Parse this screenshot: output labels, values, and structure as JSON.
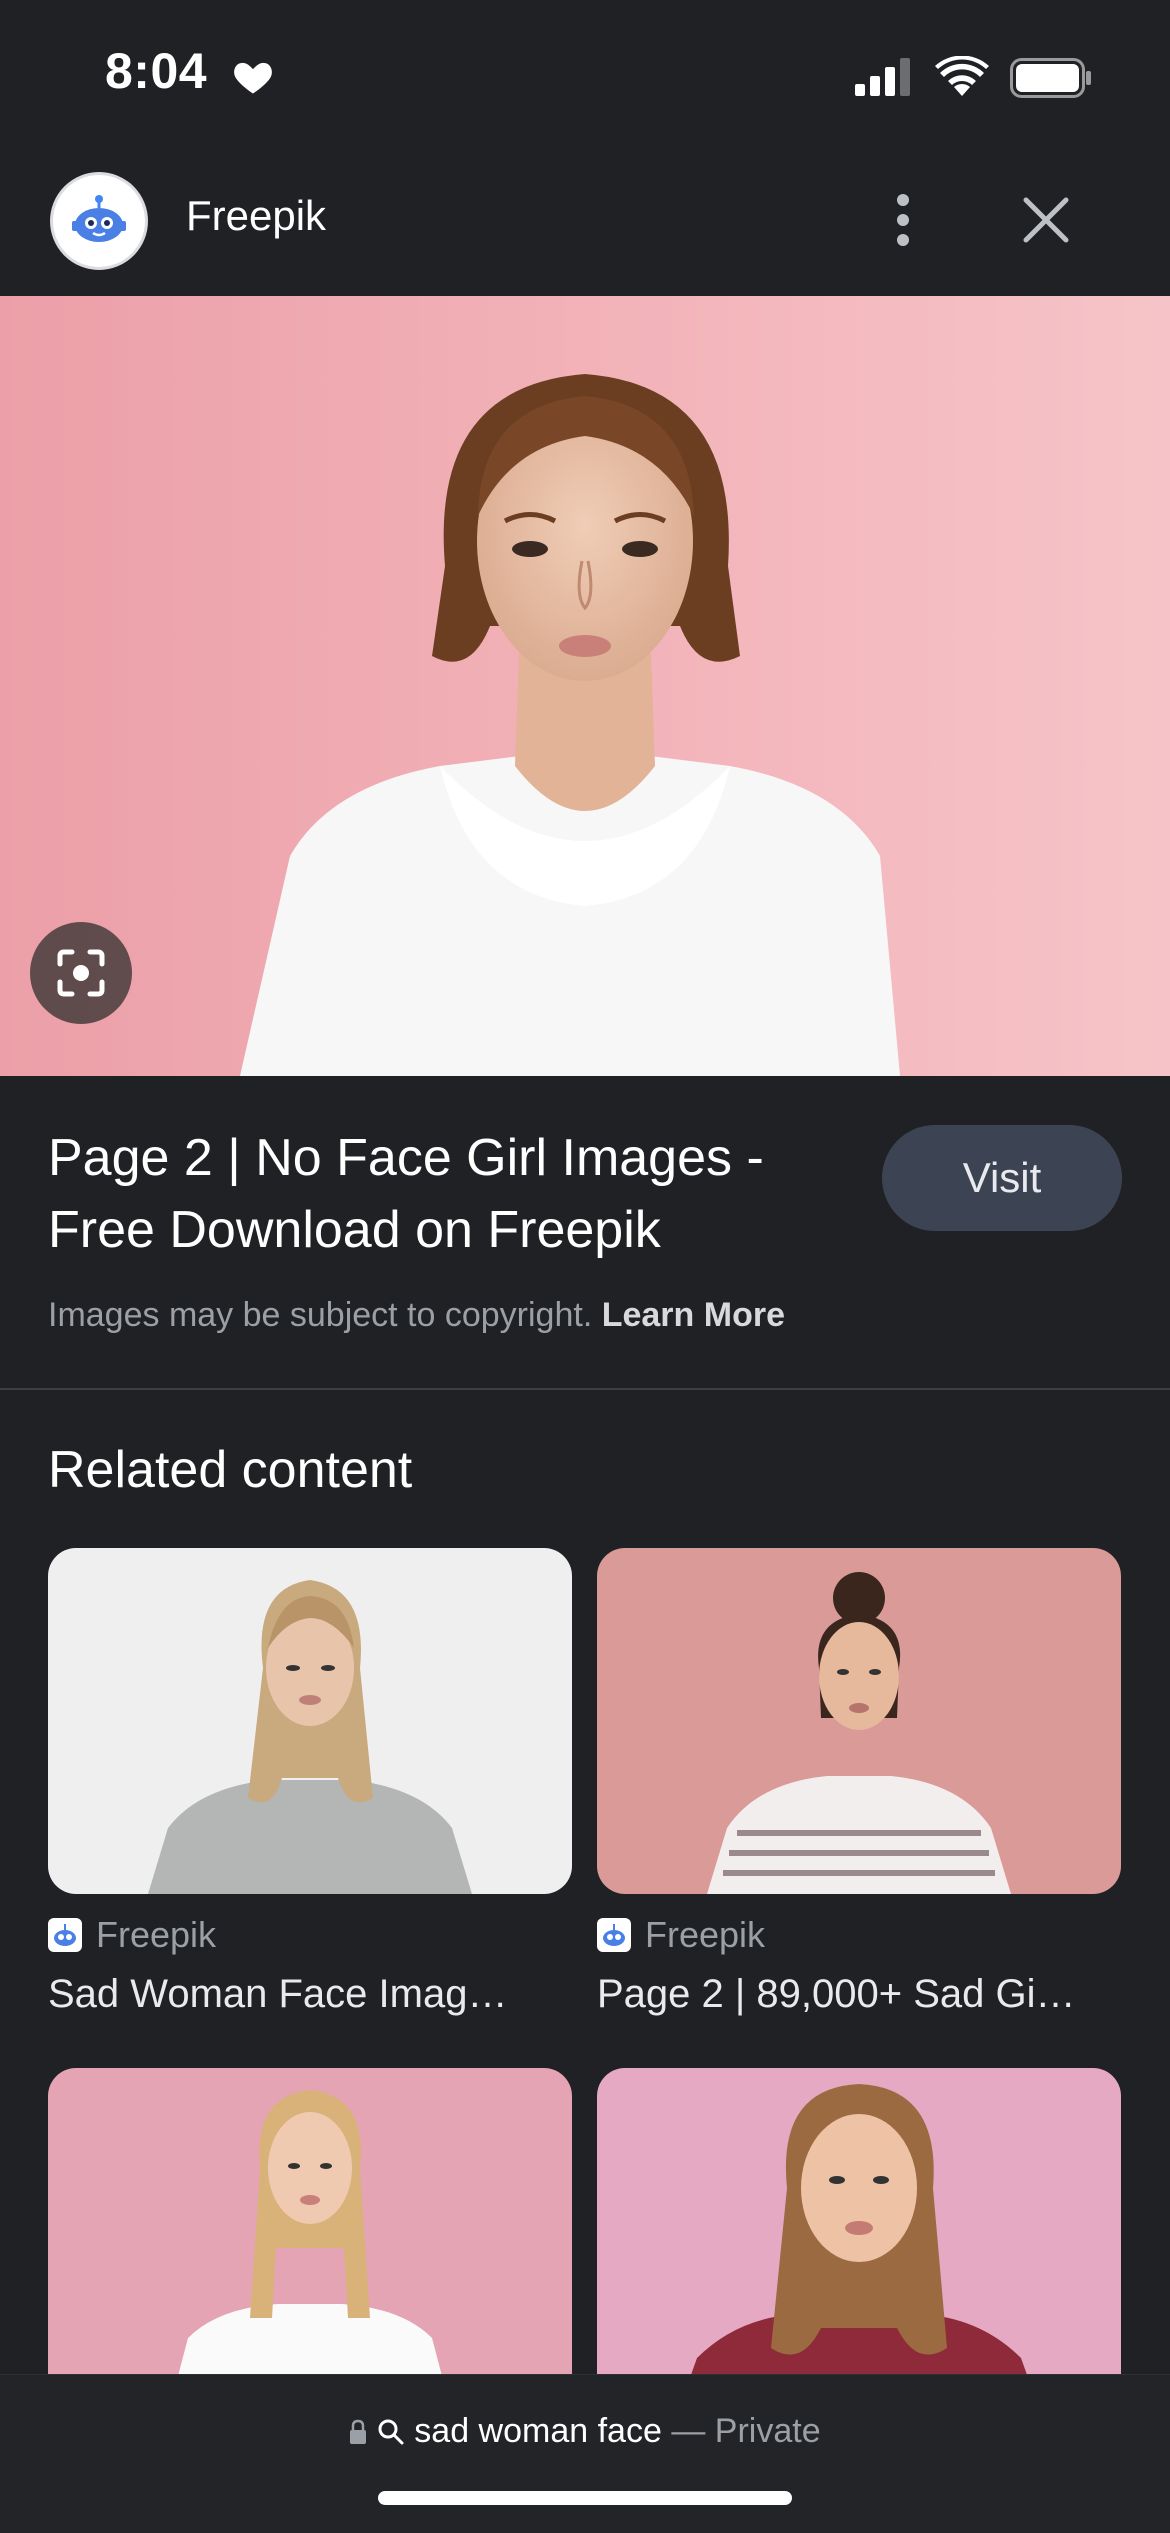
{
  "status": {
    "time": "8:04"
  },
  "header": {
    "site_name": "Freepik"
  },
  "result": {
    "title_line1": "Page 2 | No Face Girl Images -",
    "title_line2": "Free Download on Freepik",
    "visit_label": "Visit",
    "copyright_text": "Images may be subject to copyright.",
    "learn_more": "Learn More"
  },
  "related": {
    "heading": "Related content",
    "items": [
      {
        "source": "Freepik",
        "title": "Sad Woman Face Imag…"
      },
      {
        "source": "Freepik",
        "title": "Page 2 | 89,000+ Sad Gi…"
      },
      {
        "source": "",
        "title": ""
      },
      {
        "source": "",
        "title": ""
      }
    ]
  },
  "bottom": {
    "query": "sad woman face",
    "mode": "— Private"
  },
  "colors": {
    "background": "#202124",
    "visit_button": "#3c4454",
    "muted_text": "#9aa0a6",
    "hero_pink": "#f0b4ba"
  }
}
